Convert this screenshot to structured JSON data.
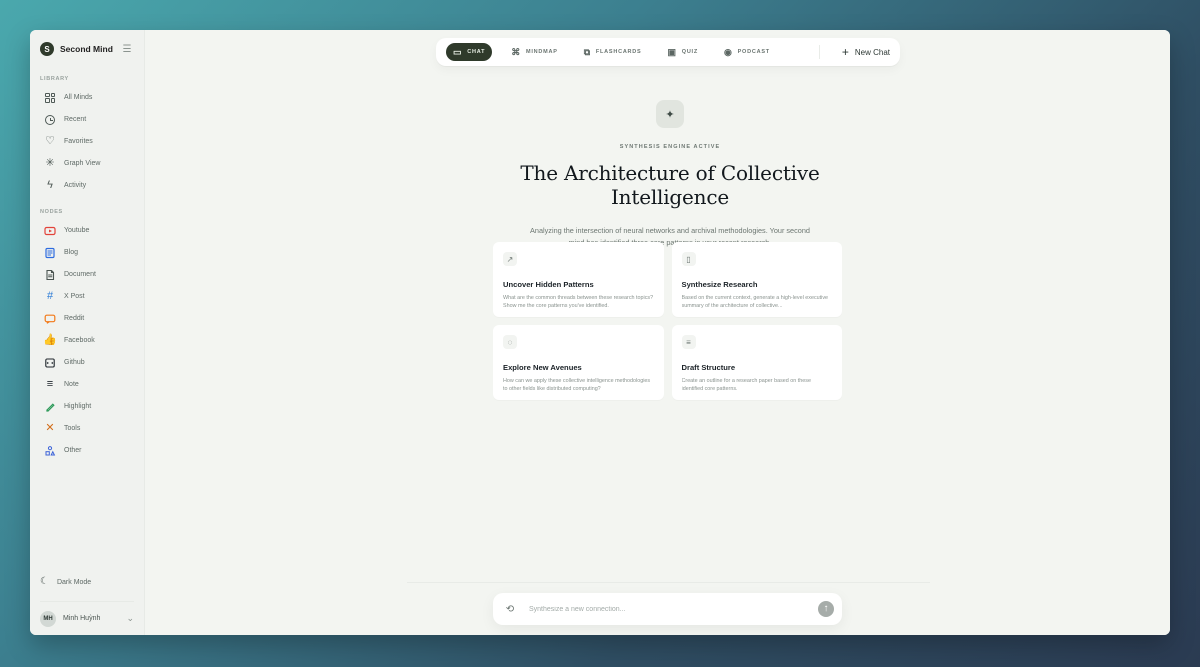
{
  "colors": {
    "accent": "#2f3a2b",
    "youtube": "#e2433a",
    "blog": "#2d6cdf",
    "document": "#4b5551",
    "xpost": "#2b7bd6",
    "reddit": "#f27a1a",
    "facebook": "#1f67e6",
    "github": "#1f262c",
    "note": "#1f262c",
    "highlight": "#2f9b5b",
    "tools": "#d26d1a",
    "other": "#3c63d8"
  },
  "sidebar": {
    "brand_initial": "S",
    "brand_name": "Second Mind",
    "collapse_icon": "sidebar-collapse-icon",
    "sections": {
      "library_label": "LIBRARY",
      "nodes_label": "NODES"
    },
    "library_items": [
      {
        "label": "All Minds",
        "icon": "grid-icon"
      },
      {
        "label": "Recent",
        "icon": "history-icon"
      },
      {
        "label": "Favorites",
        "icon": "heart-icon"
      },
      {
        "label": "Graph View",
        "icon": "graph-icon"
      },
      {
        "label": "Activity",
        "icon": "bolt-icon"
      }
    ],
    "node_items": [
      {
        "label": "Youtube",
        "icon": "youtube-icon"
      },
      {
        "label": "Blog",
        "icon": "blog-icon"
      },
      {
        "label": "Document",
        "icon": "document-icon"
      },
      {
        "label": "X Post",
        "icon": "hashtag-icon"
      },
      {
        "label": "Reddit",
        "icon": "reddit-icon"
      },
      {
        "label": "Facebook",
        "icon": "thumbs-up-icon"
      },
      {
        "label": "Github",
        "icon": "github-icon"
      },
      {
        "label": "Note",
        "icon": "note-icon"
      },
      {
        "label": "Highlight",
        "icon": "highlighter-icon"
      },
      {
        "label": "Tools",
        "icon": "tools-icon"
      },
      {
        "label": "Other",
        "icon": "shapes-icon"
      }
    ],
    "dark_mode_label": "Dark Mode",
    "profile": {
      "initials": "MH",
      "name": "Minh Huỳnh"
    }
  },
  "topbar": {
    "tabs": [
      {
        "label": "CHAT",
        "icon": "chat-icon",
        "active": true
      },
      {
        "label": "MINDMAP",
        "icon": "mindmap-icon",
        "active": false
      },
      {
        "label": "FLASHCARDS",
        "icon": "flashcards-icon",
        "active": false
      },
      {
        "label": "QUIZ",
        "icon": "quiz-icon",
        "active": false
      },
      {
        "label": "PODCAST",
        "icon": "podcast-icon",
        "active": false
      }
    ],
    "new_chat_label": "New Chat"
  },
  "hero": {
    "status": "SYNTHESIS ENGINE ACTIVE",
    "title": "The Architecture of Collective Intelligence",
    "subtitle": "Analyzing the intersection of neural networks and archival methodologies. Your second mind has identified three core patterns in your recent research."
  },
  "cards": [
    {
      "title": "Uncover Hidden Patterns",
      "desc": "What are the common threads between these research topics? Show me the core patterns you've identified.",
      "icon": "trend-icon"
    },
    {
      "title": "Synthesize Research",
      "desc": "Based on the current context, generate a high-level executive summary of the architecture of collective...",
      "icon": "document-icon"
    },
    {
      "title": "Explore New Avenues",
      "desc": "How can we apply these collective intelligence methodologies to other fields like distributed computing?",
      "icon": "compass-icon"
    },
    {
      "title": "Draft Structure",
      "desc": "Create an outline for a research paper based on these identified core patterns.",
      "icon": "list-edit-icon"
    }
  ],
  "composer": {
    "placeholder": "Synthesize a new connection..."
  }
}
